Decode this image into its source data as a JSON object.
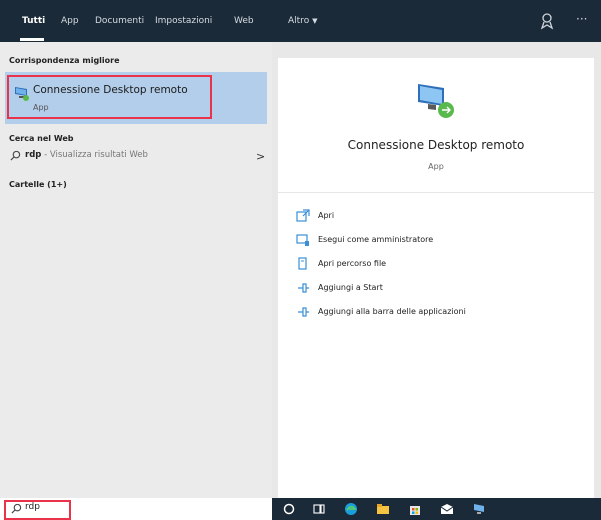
{
  "tabs": [
    {
      "label": "Tutti"
    },
    {
      "label": "App"
    },
    {
      "label": "Documenti"
    },
    {
      "label": "Impostazioni"
    },
    {
      "label": "Web"
    },
    {
      "label": "Altro"
    }
  ],
  "left": {
    "best_match_header": "Corrispondenza migliore",
    "best_match": {
      "title": "Connessione Desktop remoto",
      "subtitle": "App"
    },
    "web_header": "Cerca nel Web",
    "web_item": {
      "query": "rdp",
      "hint": " - Visualizza risultati Web"
    },
    "folders_header": "Cartelle (1+)"
  },
  "right": {
    "app_name": "Connessione Desktop remoto",
    "app_type": "App",
    "actions": [
      {
        "label": "Apri",
        "icon": "open-icon"
      },
      {
        "label": "Esegui come amministratore",
        "icon": "run-as-admin-icon"
      },
      {
        "label": "Apri percorso file",
        "icon": "open-file-location-icon"
      },
      {
        "label": "Aggiungi a Start",
        "icon": "pin-to-start-icon"
      },
      {
        "label": "Aggiungi alla barra delle applicazioni",
        "icon": "pin-to-taskbar-icon"
      }
    ]
  },
  "search": {
    "value": "rdp"
  },
  "colors": {
    "topbar": "#1b2a38",
    "selection": "#b3ceea",
    "highlight_border": "#e8334a",
    "accent": "#3a8fd6"
  }
}
